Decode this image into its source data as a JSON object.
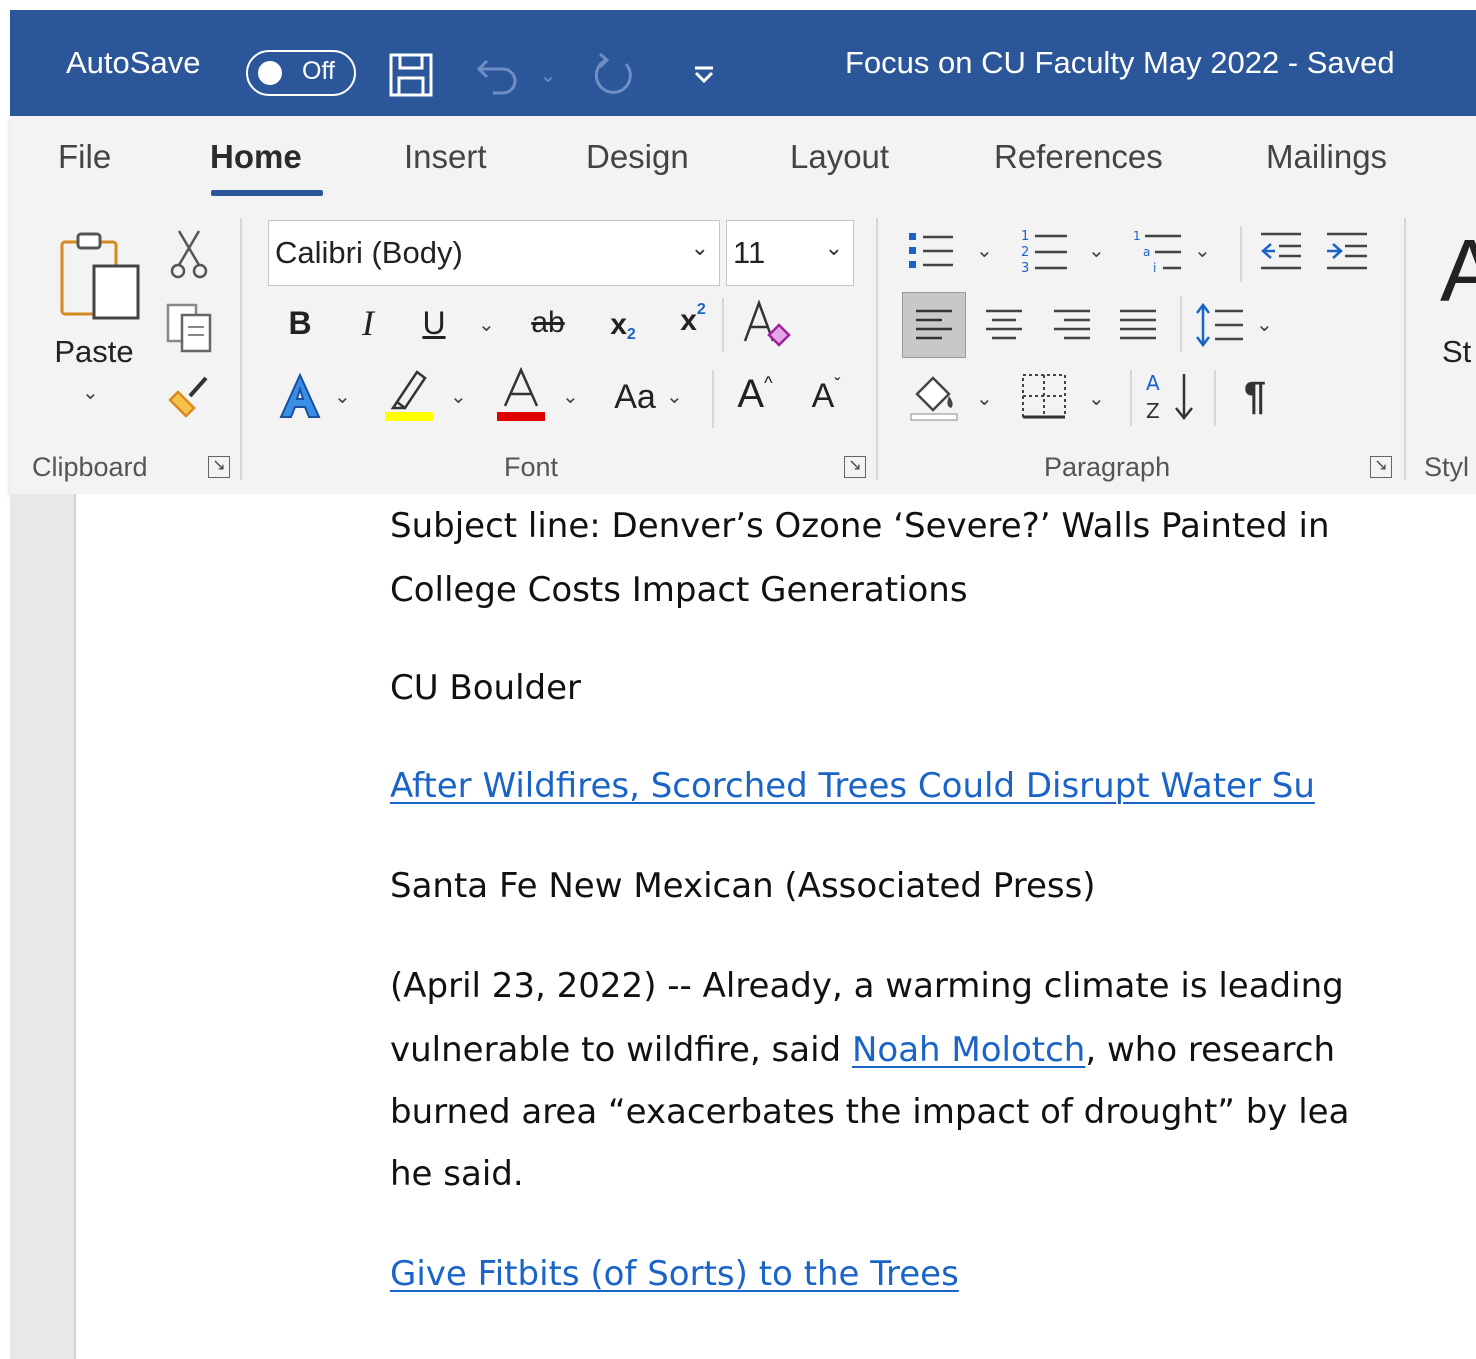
{
  "titlebar": {
    "autosave_label": "AutoSave",
    "autosave_state": "Off",
    "doc_title": "Focus on CU Faculty May 2022  -  Saved"
  },
  "tabs": [
    "File",
    "Home",
    "Insert",
    "Design",
    "Layout",
    "References",
    "Mailings"
  ],
  "active_tab": "Home",
  "clipboard": {
    "paste_label": "Paste",
    "group_label": "Clipboard"
  },
  "font": {
    "name": "Calibri (Body)",
    "size": "11",
    "group_label": "Font",
    "change_case": "Aa"
  },
  "paragraph": {
    "group_label": "Paragraph"
  },
  "styles": {
    "partial_label": "St",
    "group_label": "Styl"
  },
  "colors": {
    "titlebar": "#2b579a",
    "highlight": "#ffff00",
    "font_color": "#e00000",
    "link": "#1a63c7"
  },
  "document": {
    "line1": "Subject line: Denver’s Ozone ‘Severe?’ Walls Painted in",
    "line2": "College Costs Impact Generations",
    "source1": "CU Boulder",
    "link1": "After Wildfires, Scorched Trees Could Disrupt Water Su",
    "source2": "Santa Fe New Mexican (Associated Press)",
    "para_l1": "(April 23, 2022) -- Already, a warming climate is leading",
    "para_l2_pre": "vulnerable to wildfire, said ",
    "para_l2_link": "Noah Molotch",
    "para_l2_post": ", who research",
    "para_l3": "burned area “exacerbates the impact of drought” by lea",
    "para_l4": "he said.",
    "link2": "Give Fitbits (of Sorts) to the Trees"
  }
}
